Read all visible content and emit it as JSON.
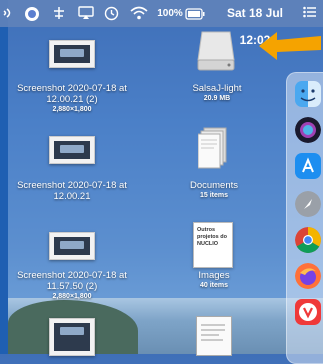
{
  "menubar": {
    "battery_percent": "100%",
    "date_time": "Sat 18 Jul 12:02"
  },
  "desktop": {
    "items": [
      {
        "label_line1": "Screenshot 2020-07-18 at",
        "label_line2": "12.00.21 (2)",
        "sub": "2,880×1,800"
      },
      {
        "label_line1": "SalsaJ-light",
        "sub": "20.9 MB"
      },
      {
        "label_line1": "Screenshot 2020-07-18 at",
        "label_line2": "12.00.21"
      },
      {
        "label_line1": "Documents",
        "sub": "15 items"
      },
      {
        "label_line1": "Screenshot 2020-07-18 at",
        "label_line2": "11.57.50 (2)",
        "sub": "2,880×1,800"
      },
      {
        "label_line1": "Images",
        "sub": "40 items",
        "doc_text": "Outros projetos do NUCLIO"
      }
    ]
  },
  "dock": {
    "icons": [
      "finder-icon",
      "siri-icon",
      "app-store-icon",
      "launchpad-icon",
      "chrome-icon",
      "firefox-icon",
      "vivaldi-icon"
    ]
  },
  "colors": {
    "arrow": "#f5a300",
    "accent": "#1f5fb2"
  }
}
